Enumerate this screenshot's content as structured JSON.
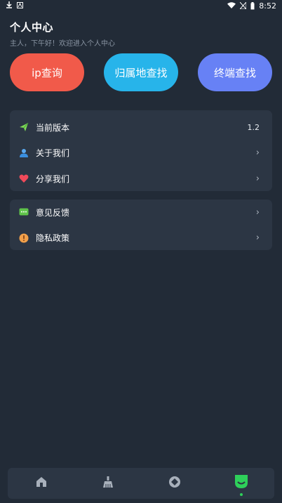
{
  "status_bar": {
    "time": "8:52"
  },
  "header": {
    "title": "个人中心",
    "greeting": "主人，下午好！欢迎进入个人中心"
  },
  "actions": [
    {
      "label": "ip查询",
      "color": "#f15a4a"
    },
    {
      "label": "归属地查找",
      "color": "#27b4ea"
    },
    {
      "label": "终端查找",
      "color": "#6781f5"
    }
  ],
  "settings_card": {
    "version": {
      "label": "当前版本",
      "value": "1.2",
      "icon": "paper-plane-icon"
    },
    "about": {
      "label": "关于我们",
      "icon": "user-icon"
    },
    "share": {
      "label": "分享我们",
      "icon": "heart-icon"
    }
  },
  "support_card": {
    "feedback": {
      "label": "意见反馈",
      "icon": "chat-bubble-icon"
    },
    "privacy": {
      "label": "隐私政策",
      "icon": "alert-circle-icon"
    }
  },
  "tabbar": {
    "tabs": [
      {
        "icon": "home-icon",
        "active": false
      },
      {
        "icon": "broom-icon",
        "active": false
      },
      {
        "icon": "target-icon",
        "active": false
      },
      {
        "icon": "profile-icon",
        "active": true
      }
    ],
    "active_color": "#2ed05a",
    "inactive_color": "#a8b0bb"
  }
}
